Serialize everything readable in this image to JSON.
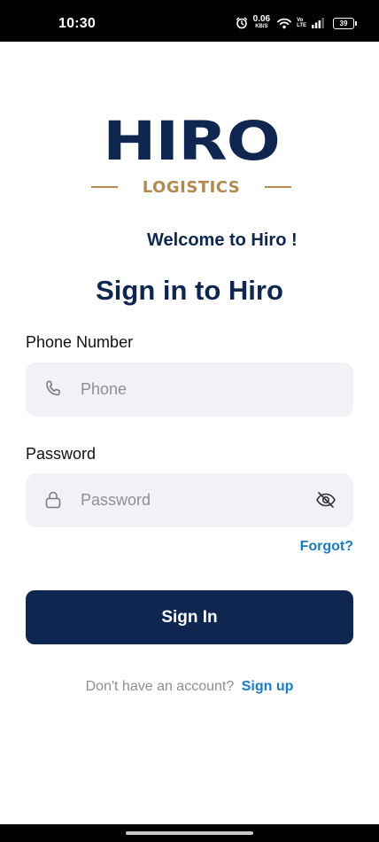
{
  "status_bar": {
    "time": "10:30",
    "net_speed_value": "0.06",
    "net_speed_unit": "KB/S",
    "volte_top": "Vo",
    "volte_bottom": "LTE",
    "battery": "39",
    "icons": [
      "alarm-icon",
      "wifi-icon",
      "signal-icon",
      "battery-icon"
    ]
  },
  "logo": {
    "word": "HIRO",
    "sub": "LOGISTICS"
  },
  "welcome": "Welcome to Hiro !",
  "title": "Sign in to Hiro",
  "phone": {
    "label": "Phone Number",
    "placeholder": "Phone",
    "value": "",
    "icon": "phone-icon"
  },
  "password": {
    "label": "Password",
    "placeholder": "Password",
    "value": "",
    "icon": "lock-icon",
    "toggle_icon": "eye-off-icon"
  },
  "forgot": "Forgot?",
  "sign_in_button": "Sign In",
  "signup": {
    "prompt": "Don't have an account?",
    "link": "Sign up"
  },
  "colors": {
    "primary": "#0e2650",
    "accent_gold": "#b08a4f",
    "link": "#1a7cc4",
    "input_bg": "#f1f1f6",
    "placeholder": "#8e8e95"
  }
}
